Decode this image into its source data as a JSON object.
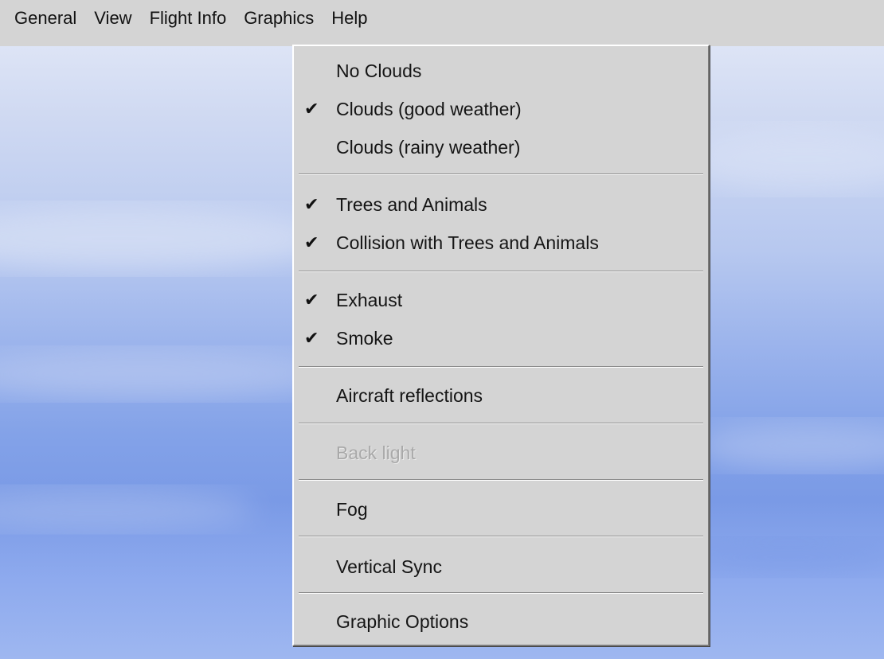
{
  "menubar": {
    "items": [
      "General",
      "View",
      "Flight Info",
      "Graphics",
      "Help"
    ]
  },
  "graphics_menu": {
    "items": [
      {
        "label": "No Clouds",
        "checked": false,
        "disabled": false
      },
      {
        "label": "Clouds (good weather)",
        "checked": true,
        "disabled": false
      },
      {
        "label": "Clouds (rainy weather)",
        "checked": false,
        "disabled": false
      },
      {
        "label": "Trees and Animals",
        "checked": true,
        "disabled": false
      },
      {
        "label": "Collision with Trees and Animals",
        "checked": true,
        "disabled": false
      },
      {
        "label": "Exhaust",
        "checked": true,
        "disabled": false
      },
      {
        "label": "Smoke",
        "checked": true,
        "disabled": false
      },
      {
        "label": "Aircraft reflections",
        "checked": false,
        "disabled": false
      },
      {
        "label": "Back light",
        "checked": false,
        "disabled": true
      },
      {
        "label": "Fog",
        "checked": false,
        "disabled": false
      },
      {
        "label": "Vertical Sync",
        "checked": false,
        "disabled": false
      },
      {
        "label": "Graphic Options",
        "checked": false,
        "disabled": false
      }
    ],
    "check_glyph": "✔"
  }
}
